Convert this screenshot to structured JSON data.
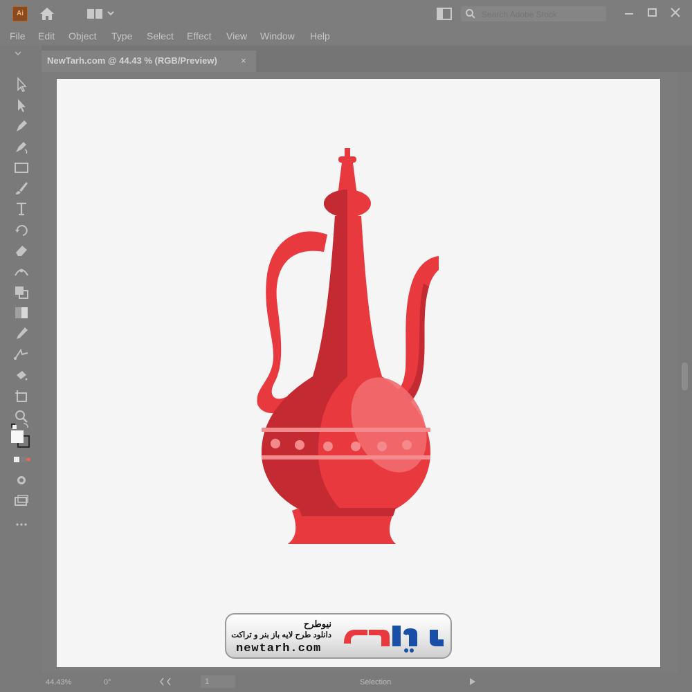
{
  "app": {
    "logo_text": "Ai"
  },
  "search": {
    "placeholder": "Search Adobe Stock"
  },
  "menu": [
    "File",
    "Edit",
    "Object",
    "Type",
    "Select",
    "Effect",
    "View",
    "Window",
    "Help"
  ],
  "document": {
    "tab_title": "NewTarh.com @ 44.43 % (RGB/Preview)",
    "close_glyph": "×"
  },
  "status": {
    "zoom": "44.43%",
    "rotation": "0°",
    "page": "1",
    "mode": "Selection"
  },
  "watermark": {
    "name": "نیوطرح",
    "tagline": "دانلود طرح لایه باز بنر و تراکت",
    "url": "newtarh.com",
    "logo_text": "نیوطرح"
  },
  "artwork": {
    "subject": "red-ewer-illustration",
    "colors": {
      "primary": "#e8393f",
      "shade": "#c42a32",
      "highlight": "#f26b6e",
      "band": "#f58a8c"
    }
  },
  "toolbar_tools": [
    "selection",
    "direct-selection",
    "pen",
    "curvature",
    "rectangle",
    "paintbrush",
    "type",
    "rotate",
    "eraser",
    "width",
    "shape-builder",
    "gradient",
    "eyedropper",
    "blend",
    "symbol-sprayer",
    "artboard",
    "zoom"
  ]
}
